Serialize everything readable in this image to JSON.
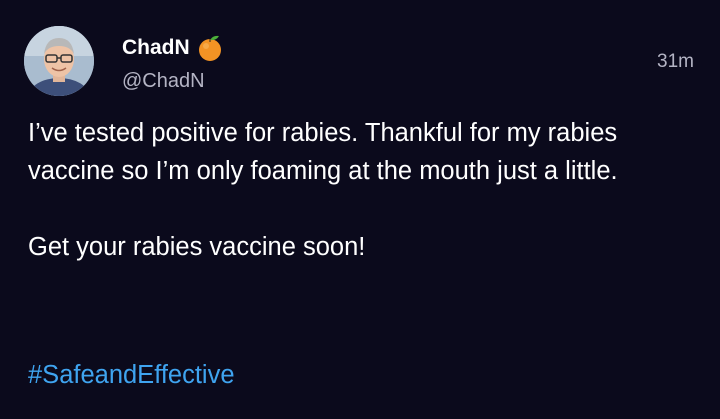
{
  "post": {
    "author": {
      "display_name": "ChadN",
      "handle": "@ChadN",
      "badge_icon": "orange-fruit-icon",
      "avatar_icon": "profile-photo"
    },
    "timestamp": "31m",
    "body": {
      "paragraph_1": "I’ve tested positive for rabies. Thankful for my rabies vaccine so I’m only foaming at the mouth just a little.",
      "paragraph_2": "Get your rabies vaccine soon!"
    },
    "hashtag": "#SafeandEffective"
  },
  "colors": {
    "background": "#0b0a1c",
    "primary_text": "#ffffff",
    "secondary_text": "#b4b4c4",
    "link": "#3fa4f0"
  }
}
